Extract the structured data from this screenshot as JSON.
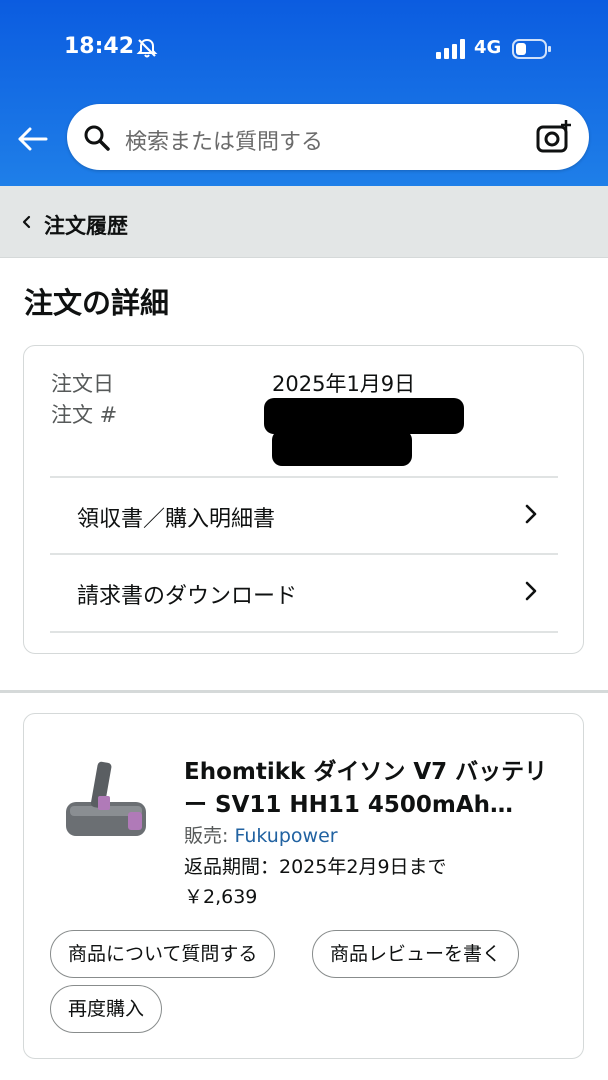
{
  "status_bar": {
    "time": "18:42",
    "network": "4G"
  },
  "search": {
    "placeholder": "検索または質問する"
  },
  "breadcrumb": {
    "label": "注文履歴"
  },
  "page": {
    "title": "注文の詳細"
  },
  "order": {
    "date_label": "注文日",
    "date_value": "2025年1月9日",
    "number_label": "注文 #",
    "links": [
      {
        "label": "領収書／購入明細書"
      },
      {
        "label": "請求書のダウンロード"
      }
    ]
  },
  "product": {
    "title": "Ehomtikk ダイソン V7 バッテリー SV11 HH11 4500mAh…",
    "seller_prefix": "販売: ",
    "seller_name": "Fukupower",
    "return_period": "返品期間：2025年2月9日まで",
    "price": "￥2,639",
    "actions": [
      {
        "label": "商品について質問する"
      },
      {
        "label": "商品レビューを書く"
      },
      {
        "label": "再度購入"
      }
    ]
  },
  "colors": {
    "header_blue": "#1a6fe6",
    "link_blue": "#2162a1"
  },
  "icons": [
    "muted-bell-icon",
    "signal-icon",
    "battery-icon",
    "back-arrow-icon",
    "search-icon",
    "camera-search-icon",
    "chevron-left-icon",
    "chevron-right-icon"
  ]
}
